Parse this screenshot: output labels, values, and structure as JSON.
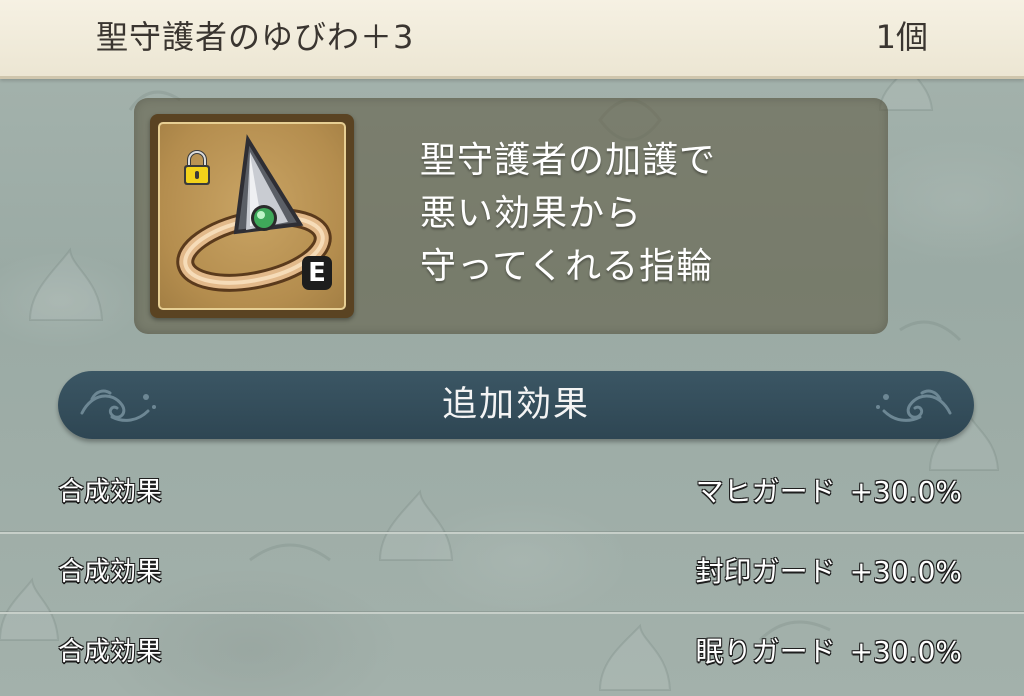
{
  "header": {
    "item_name": "聖守護者のゆびわ＋3",
    "count": "1個"
  },
  "item": {
    "icon": "ring-icon",
    "locked": true,
    "lock_icon": "padlock-icon",
    "equipped_badge": "E",
    "description_lines": [
      "聖守護者の加護で",
      "悪い効果から",
      "守ってくれる指輪"
    ]
  },
  "section": {
    "title": "追加効果"
  },
  "effects": [
    {
      "label": "合成効果",
      "name": "マヒガード",
      "value": "+30.0%"
    },
    {
      "label": "合成効果",
      "name": "封印ガード",
      "value": "+30.0%"
    },
    {
      "label": "合成効果",
      "name": "眠りガード",
      "value": "+30.0%"
    }
  ],
  "colors": {
    "header_bg": "#f6f1e3",
    "banner_bg": "#34505d",
    "icon_bg": "#b48d4e",
    "page_bg": "#9eaea8"
  }
}
